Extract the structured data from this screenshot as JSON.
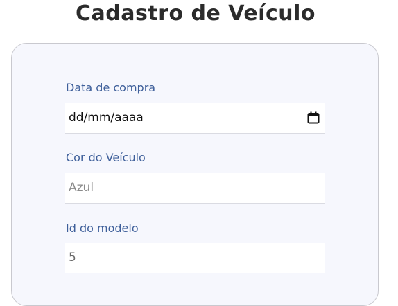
{
  "page": {
    "title": "Cadastro de Veículo"
  },
  "form": {
    "purchase_date": {
      "label": "Data de compra",
      "placeholder_display": "dd/mm/aaaa",
      "icon": "calendar-icon"
    },
    "vehicle_color": {
      "label": "Cor do Veículo",
      "placeholder": "Azul",
      "value": ""
    },
    "model_id": {
      "label": "Id do modelo",
      "value": "5"
    }
  },
  "colors": {
    "label": "#3e5f9a",
    "card_background": "#f6f7fd",
    "title": "#2b2b2b"
  }
}
